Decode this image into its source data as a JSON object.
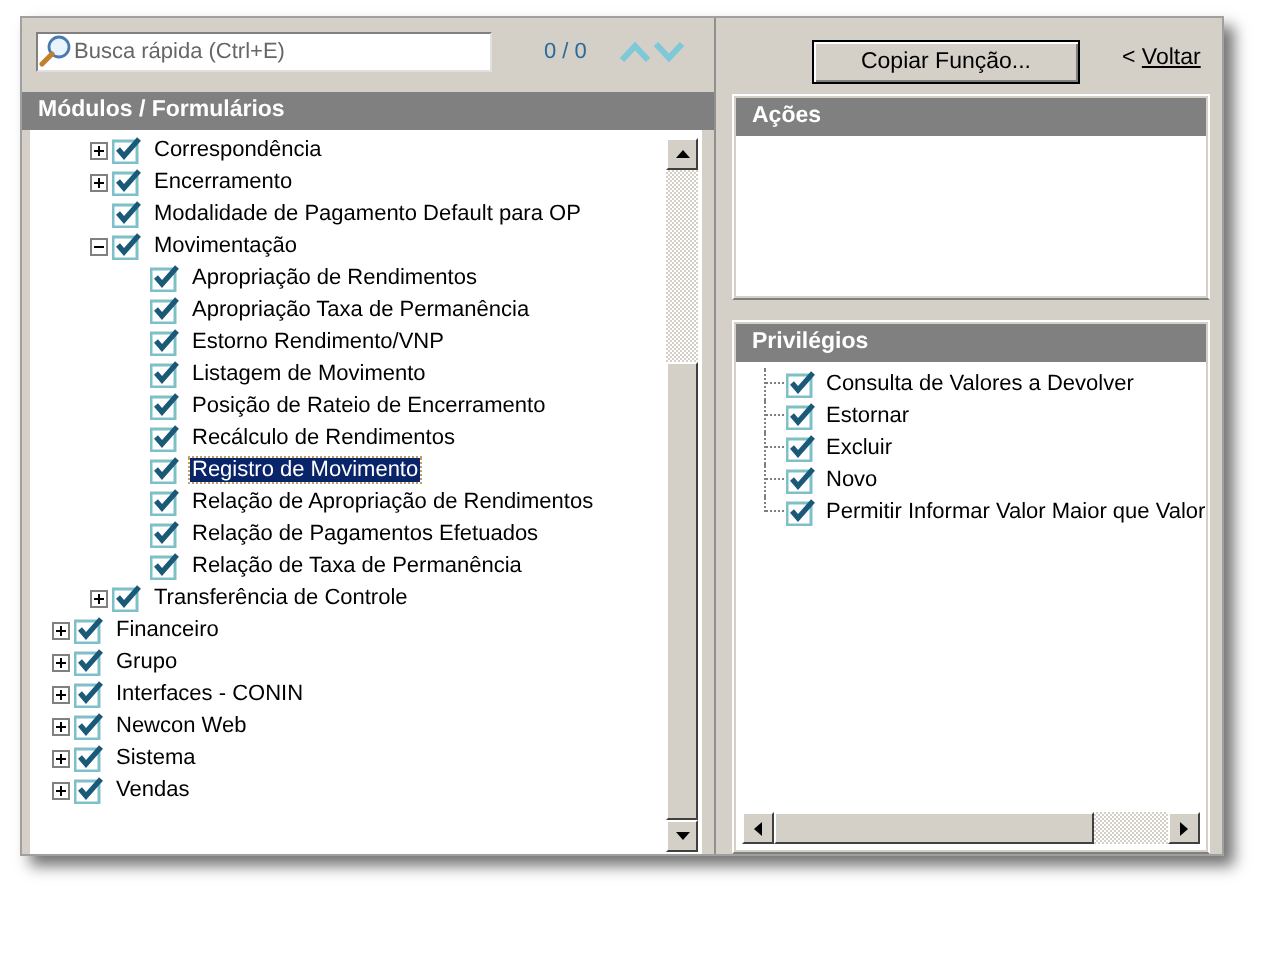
{
  "search": {
    "placeholder": "Busca rápida (Ctrl+E)",
    "count": "0 / 0"
  },
  "copy_button": "Copiar Função...",
  "back_link": {
    "arrow": "<",
    "label": "Voltar"
  },
  "modules": {
    "title": "Módulos / Formulários",
    "tree": [
      {
        "children": [
          {
            "label": "Correspondência",
            "checked": true,
            "expanded": false,
            "selected": false
          },
          {
            "label": "Encerramento",
            "checked": true,
            "expanded": false,
            "selected": false
          },
          {
            "label": "Modalidade de Pagamento Default para OP",
            "checked": true,
            "selected": false
          },
          {
            "label": "Movimentação",
            "checked": true,
            "expanded": true,
            "selected": false,
            "children": [
              {
                "label": "Apropriação de Rendimentos",
                "checked": true,
                "selected": false
              },
              {
                "label": "Apropriação Taxa de Permanência",
                "checked": true,
                "selected": false
              },
              {
                "label": "Estorno Rendimento/VNP",
                "checked": true,
                "selected": false
              },
              {
                "label": "Listagem de Movimento",
                "checked": true,
                "selected": false
              },
              {
                "label": "Posição de Rateio de Encerramento",
                "checked": true,
                "selected": false
              },
              {
                "label": "Recálculo de Rendimentos",
                "checked": true,
                "selected": false
              },
              {
                "label": "Registro de Movimento",
                "checked": true,
                "selected": true
              },
              {
                "label": "Relação de Apropriação de Rendimentos",
                "checked": true,
                "selected": false
              },
              {
                "label": "Relação de Pagamentos Efetuados",
                "checked": true,
                "selected": false
              },
              {
                "label": "Relação de Taxa de Permanência",
                "checked": true,
                "selected": false
              }
            ]
          },
          {
            "label": "Transferência de Controle",
            "checked": true,
            "expanded": false,
            "selected": false
          }
        ]
      },
      {
        "label": "Financeiro",
        "checked": true,
        "expanded": false,
        "selected": false
      },
      {
        "label": "Grupo",
        "checked": true,
        "expanded": false,
        "selected": false
      },
      {
        "label": "Interfaces - CONIN",
        "checked": true,
        "expanded": false,
        "selected": false
      },
      {
        "label": "Newcon Web",
        "checked": true,
        "expanded": false,
        "selected": false
      },
      {
        "label": "Sistema",
        "checked": true,
        "expanded": false,
        "selected": false
      },
      {
        "label": "Vendas",
        "checked": true,
        "expanded": false,
        "selected": false
      }
    ]
  },
  "actions": {
    "title": "Ações"
  },
  "privileges": {
    "title": "Privilégios",
    "items": [
      {
        "label": "Consulta de Valores a Devolver",
        "checked": true
      },
      {
        "label": "Estornar",
        "checked": true
      },
      {
        "label": "Excluir",
        "checked": true
      },
      {
        "label": "Novo",
        "checked": true
      },
      {
        "label": "Permitir Informar Valor Maior que Valor",
        "checked": true
      }
    ]
  }
}
